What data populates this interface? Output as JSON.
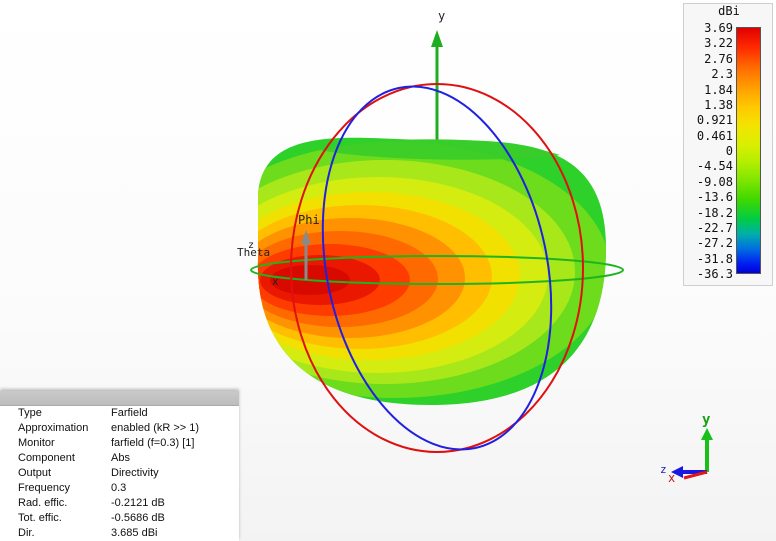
{
  "scene": {
    "axis_y_label": "y",
    "phi_label": "Phi",
    "theta_label": "Theta",
    "x_label": "x",
    "z_label": "z"
  },
  "legend": {
    "unit": "dBi",
    "labels": [
      "3.69",
      "3.22",
      "2.76",
      "2.3",
      "1.84",
      "1.38",
      "0.921",
      "0.461",
      "0",
      "-4.54",
      "-9.08",
      "-13.6",
      "-18.2",
      "-22.7",
      "-27.2",
      "-31.8",
      "-36.3"
    ],
    "colors": [
      "#e10000",
      "#ff6a00",
      "#ffc800",
      "#d8ef00",
      "#80e600",
      "#00cc44",
      "#0070e0",
      "#0000d8"
    ]
  },
  "info": {
    "rows": [
      {
        "key": "Type",
        "value": "Farfield"
      },
      {
        "key": "Approximation",
        "value": "enabled (kR >> 1)"
      },
      {
        "key": "Monitor",
        "value": "farfield (f=0.3) [1]"
      },
      {
        "key": "Component",
        "value": "Abs"
      },
      {
        "key": "Output",
        "value": "Directivity"
      },
      {
        "key": "Frequency",
        "value": "0.3"
      },
      {
        "key": "Rad. effic.",
        "value": "-0.2121 dB"
      },
      {
        "key": "Tot. effic.",
        "value": "-0.5686 dB"
      },
      {
        "key": "Dir.",
        "value": "3.685 dBi"
      }
    ]
  },
  "triad": {
    "y_label": "y",
    "z_label": "z",
    "x_label": "x",
    "colors": {
      "y": "#18c018",
      "x": "#e01818",
      "z": "#1818e0"
    }
  }
}
